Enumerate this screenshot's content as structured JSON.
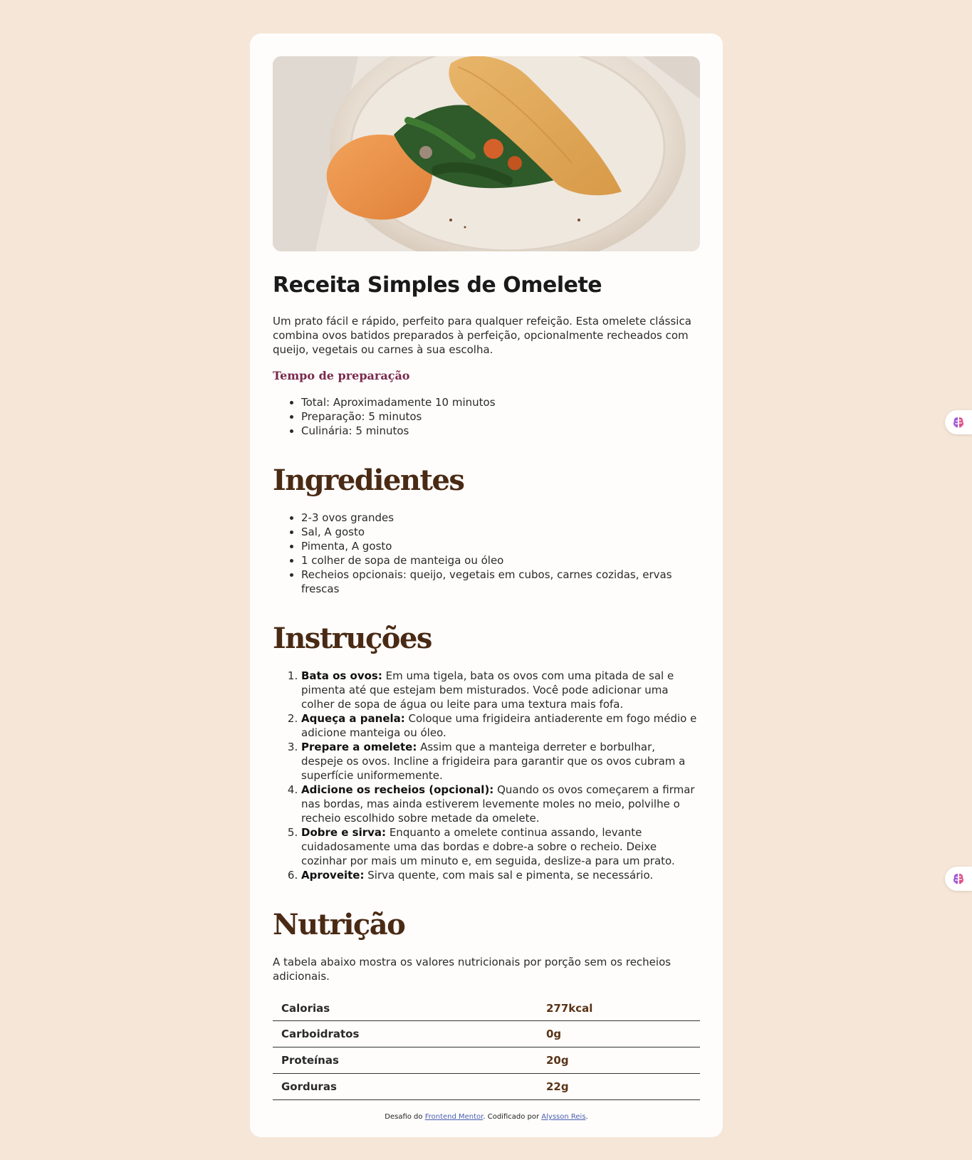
{
  "recipe": {
    "title": "Receita Simples de Omelete",
    "description": "Um prato fácil e rápido, perfeito para qualquer refeição. Esta omelete clássica combina ovos batidos preparados à perfeição, opcionalmente recheados com queijo, vegetais ou carnes à sua escolha."
  },
  "preparation": {
    "heading": "Tempo de preparação",
    "items": [
      {
        "label": "Total:",
        "text": " Aproximadamente 10 minutos"
      },
      {
        "label": "Preparação:",
        "text": " 5 minutos"
      },
      {
        "label": "Culinária:",
        "text": " 5 minutos"
      }
    ]
  },
  "ingredients": {
    "heading": "Ingredientes",
    "items": [
      "2-3 ovos grandes",
      "Sal, A gosto",
      "Pimenta, A gosto",
      "1 colher de sopa de manteiga ou óleo",
      "Recheios opcionais: queijo, vegetais em cubos, carnes cozidas, ervas frescas"
    ]
  },
  "instructions": {
    "heading": "Instruções",
    "steps": [
      {
        "title": "Bata os ovos:",
        "text": " Em uma tigela, bata os ovos com uma pitada de sal e pimenta até que estejam bem misturados. Você pode adicionar uma colher de sopa de água ou leite para uma textura mais fofa."
      },
      {
        "title": "Aqueça a panela:",
        "text": " Coloque uma frigideira antiaderente em fogo médio e adicione manteiga ou óleo."
      },
      {
        "title": "Prepare a omelete:",
        "text": " Assim que a manteiga derreter e borbulhar, despeje os ovos. Incline a frigideira para garantir que os ovos cubram a superfície uniformemente."
      },
      {
        "title": "Adicione os recheios (opcional):",
        "text": " Quando os ovos começarem a firmar nas bordas, mas ainda estiverem levemente moles no meio, polvilhe o recheio escolhido sobre metade da omelete."
      },
      {
        "title": "Dobre e sirva:",
        "text": " Enquanto a omelete continua assando, levante cuidadosamente uma das bordas e dobre-a sobre o recheio. Deixe cozinhar por mais um minuto e, em seguida, deslize-a para um prato."
      },
      {
        "title": "Aproveite:",
        "text": " Sirva quente, com mais sal e pimenta, se necessário."
      }
    ]
  },
  "nutrition": {
    "heading": "Nutrição",
    "intro": "A tabela abaixo mostra os valores nutricionais por porção sem os recheios adicionais.",
    "rows": [
      {
        "label": "Calorias",
        "value": "277kcal"
      },
      {
        "label": "Carboidratos",
        "value": "0g"
      },
      {
        "label": "Proteínas",
        "value": "20g"
      },
      {
        "label": "Gorduras",
        "value": "22g"
      }
    ]
  },
  "footer": {
    "prefix": "Desafio do ",
    "link1": "Frontend Mentor",
    "middle": ". Codificado por ",
    "link2": "Alysson Reis",
    "suffix": "."
  },
  "widgets": {
    "icon": "brain-icon"
  },
  "colors": {
    "page_bg": "#f5e6d7",
    "card_bg": "#fefdfc",
    "heading_brown": "#4a2a14",
    "prep_heading": "#7a284b"
  }
}
